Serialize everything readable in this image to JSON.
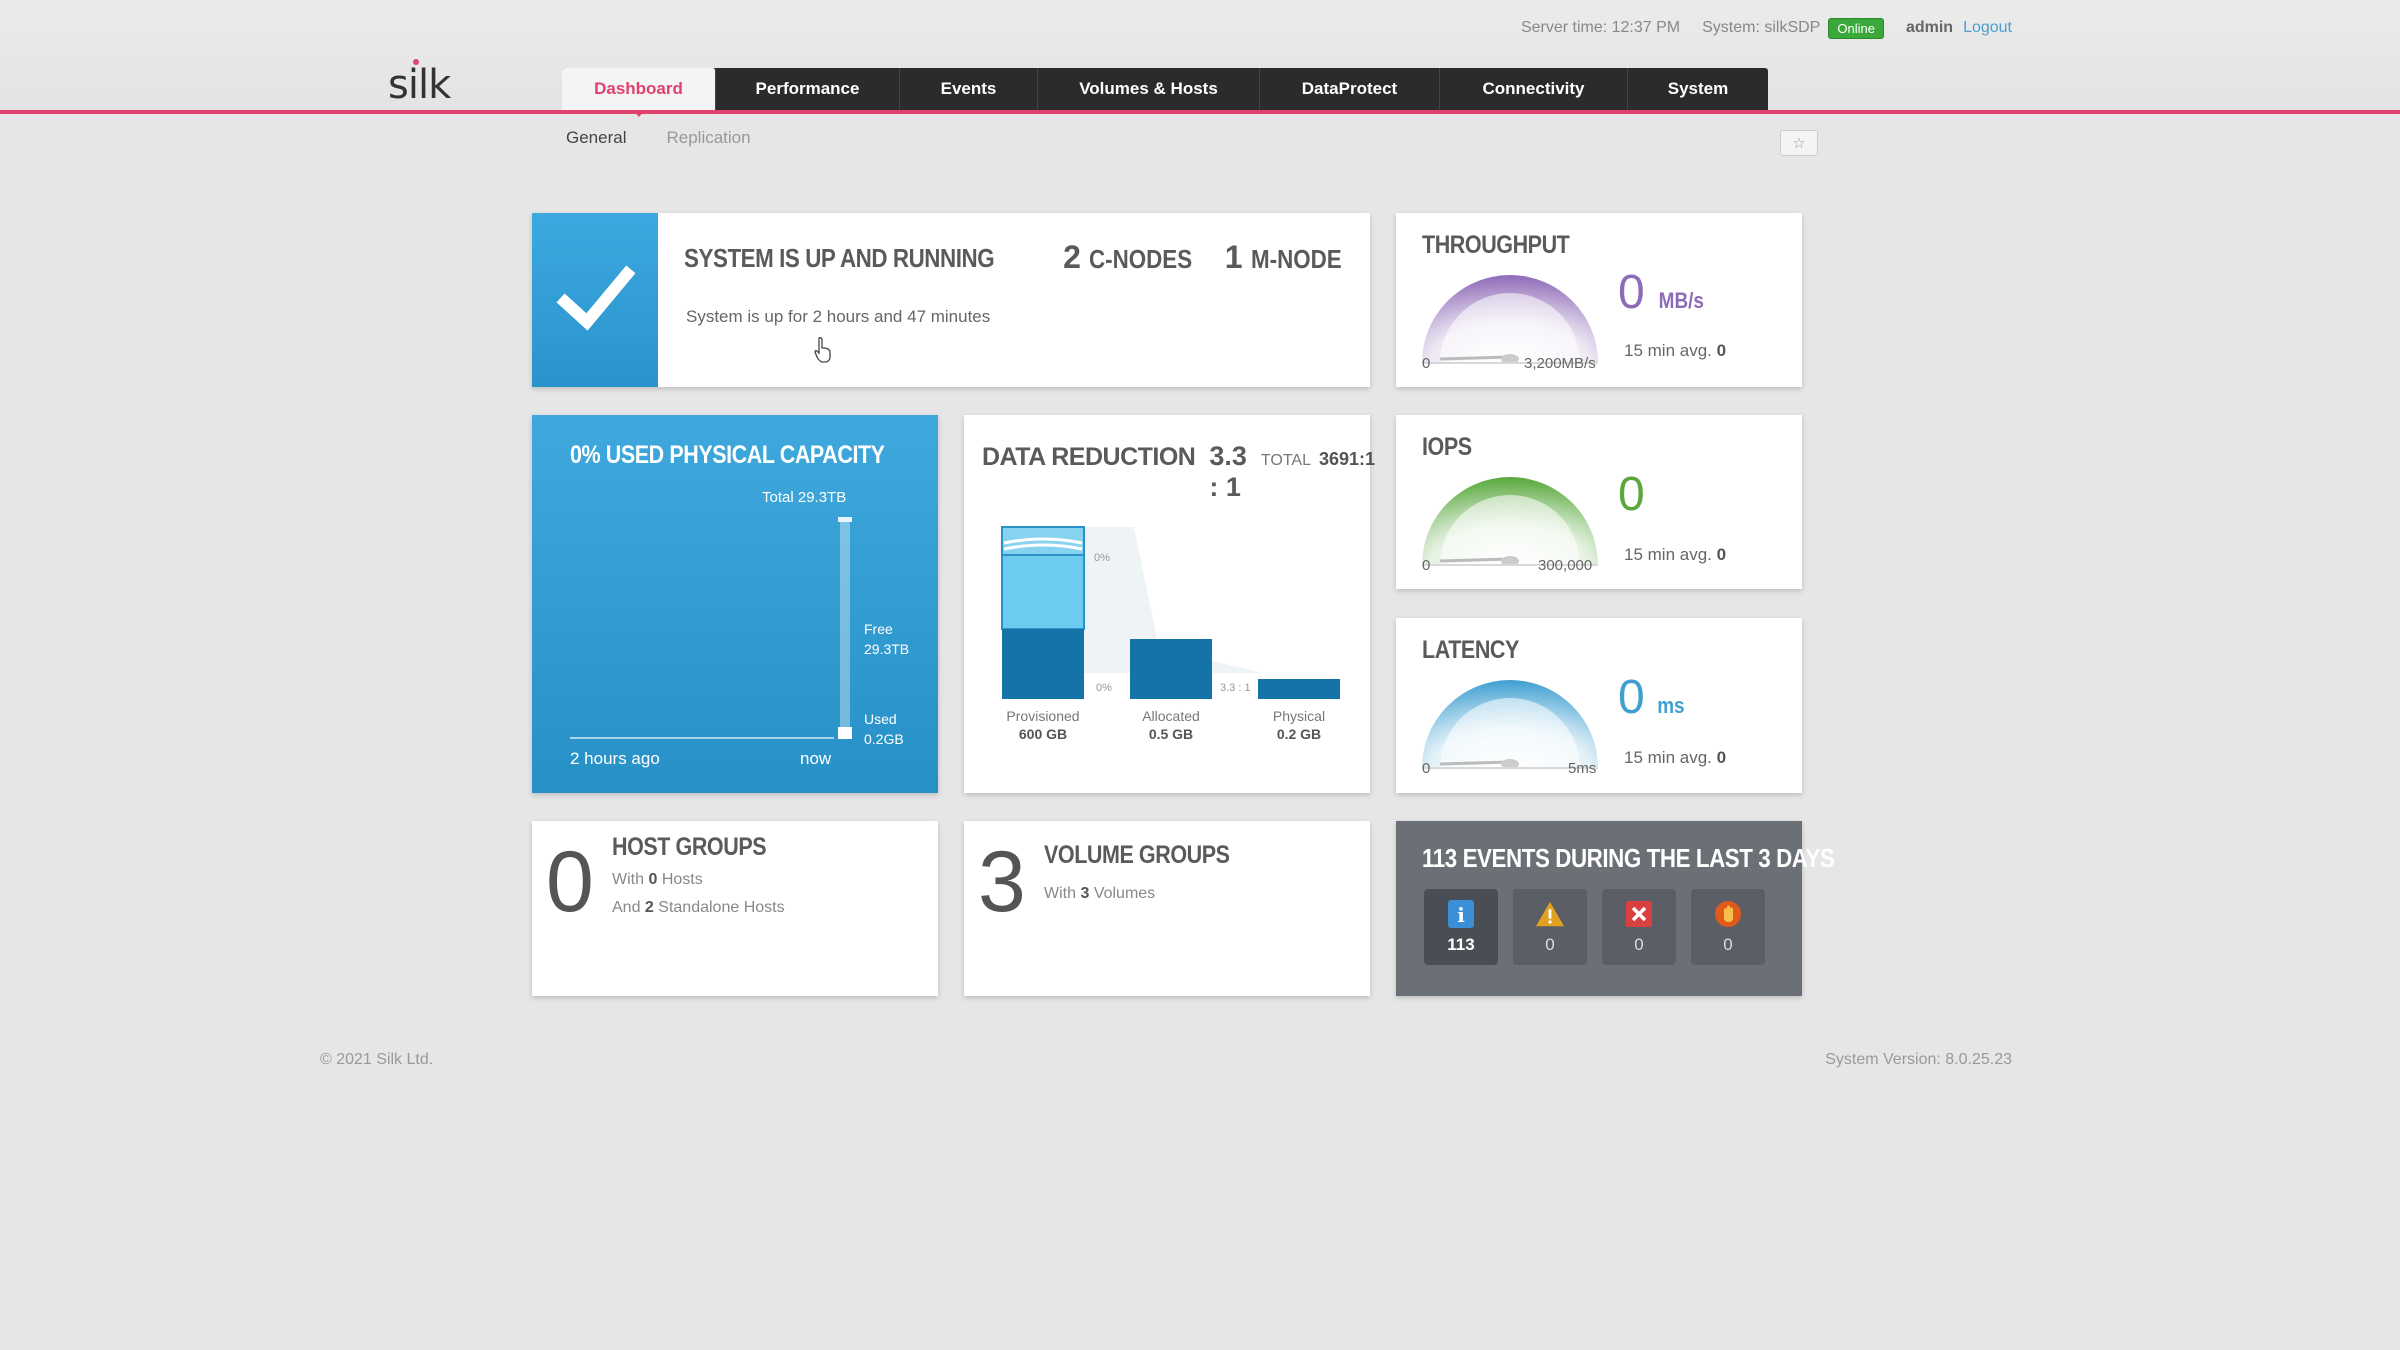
{
  "header": {
    "server_time": "Server time: 12:37 PM",
    "system": "System: silkSDP",
    "status": "Online",
    "user": "admin",
    "logout": "Logout",
    "logo": "silk"
  },
  "nav": {
    "tabs": [
      {
        "label": "Dashboard",
        "active": true
      },
      {
        "label": "Performance"
      },
      {
        "label": "Events"
      },
      {
        "label": "Volumes & Hosts"
      },
      {
        "label": "DataProtect"
      },
      {
        "label": "Connectivity"
      },
      {
        "label": "System"
      }
    ],
    "subtabs": [
      {
        "label": "General",
        "active": true
      },
      {
        "label": "Replication"
      }
    ],
    "favorite_icon": "star-icon"
  },
  "system_status": {
    "title": "SYSTEM IS UP AND RUNNING",
    "c_nodes_count": "2",
    "c_nodes_label": "C-NODES",
    "m_nodes_count": "1",
    "m_nodes_label": "M-NODE",
    "uptime": "System is up for 2 hours and 47 minutes",
    "icon": "checkmark-icon"
  },
  "throughput": {
    "title": "THROUGHPUT",
    "value": "0",
    "unit": "MB/s",
    "min_label": "0",
    "max_label": "3,200MB/s",
    "avg_label": "15 min avg.",
    "avg_value": "0",
    "level": 0,
    "color": "#8e6bb8"
  },
  "iops": {
    "title": "IOPS",
    "value": "0",
    "unit": "",
    "min_label": "0",
    "max_label": "300,000",
    "avg_label": "15 min avg.",
    "avg_value": "0",
    "level": 0,
    "color": "#58a83c"
  },
  "latency": {
    "title": "LATENCY",
    "value": "0",
    "unit": "ms",
    "min_label": "0",
    "max_label": "5ms",
    "avg_label": "15 min avg.",
    "avg_value": "0",
    "level": 0,
    "color": "#3f9fd1"
  },
  "capacity": {
    "title": "0% USED PHYSICAL CAPACITY",
    "total": "Total 29.3TB",
    "free_label": "Free",
    "free_value": "29.3TB",
    "used_label": "Used",
    "used_value": "0.2GB",
    "start_label": "2 hours ago",
    "end_label": "now"
  },
  "data_reduction": {
    "title": "DATA REDUCTION",
    "ratio": "3.3 : 1",
    "total_label": "TOTAL",
    "total_value": "3691:1",
    "pct_top": "0%",
    "pct_mid": "0%",
    "ratio_small": "3.3 : 1",
    "bars": [
      {
        "label": "Provisioned",
        "value": "600 GB"
      },
      {
        "label": "Allocated",
        "value": "0.5 GB"
      },
      {
        "label": "Physical",
        "value": "0.2 GB"
      }
    ]
  },
  "host_groups": {
    "count": "0",
    "title": "HOST GROUPS",
    "line1_prefix": "With",
    "line1_num": "0",
    "line1_suffix": "Hosts",
    "line2_prefix": "And",
    "line2_num": "2",
    "line2_suffix": "Standalone Hosts"
  },
  "volume_groups": {
    "count": "3",
    "title": "VOLUME GROUPS",
    "line1_prefix": "With",
    "line1_num": "3",
    "line1_suffix": "Volumes"
  },
  "events": {
    "title": "113 EVENTS DURING THE LAST 3 DAYS",
    "items": [
      {
        "icon": "info-icon",
        "count": "113",
        "color": "#3a8fd6"
      },
      {
        "icon": "warning-icon",
        "count": "0",
        "color": "#e0a020"
      },
      {
        "icon": "error-icon",
        "count": "0",
        "color": "#d94040"
      },
      {
        "icon": "critical-icon",
        "count": "0",
        "color": "#e05a1a"
      }
    ]
  },
  "footer": {
    "copyright": "© 2021 Silk Ltd.",
    "version": "System Version: 8.0.25.23"
  }
}
